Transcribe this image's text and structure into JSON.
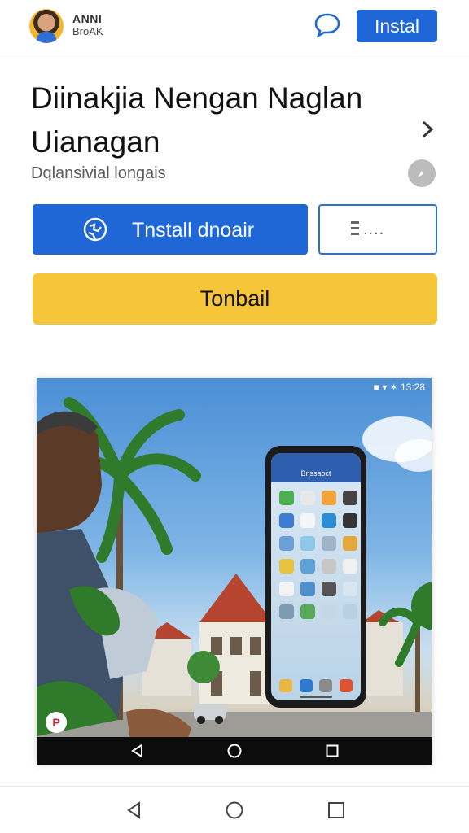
{
  "header": {
    "brand_line1": "ANNI",
    "brand_line2": "BroAK",
    "install_label": "Instal"
  },
  "app": {
    "title": "Diinakjia Nengan Naglan Uianagan",
    "subtitle": "Dqlansivial longais"
  },
  "actions": {
    "install_label": "Tnstall dnoair",
    "more_label": "....",
    "secondary_label": "Tonbail"
  },
  "screenshot": {
    "status_text": "■ ▾ ✶ 13:28",
    "phone_header": "Bnssaoct",
    "badge": "P"
  },
  "colors": {
    "primary": "#1f66d6",
    "secondary": "#f6c63a"
  },
  "icons": [
    "chat-bubble-icon",
    "chevron-right-icon",
    "info-icon",
    "globe-icon",
    "list-icon",
    "back-icon",
    "home-icon",
    "recents-icon"
  ]
}
